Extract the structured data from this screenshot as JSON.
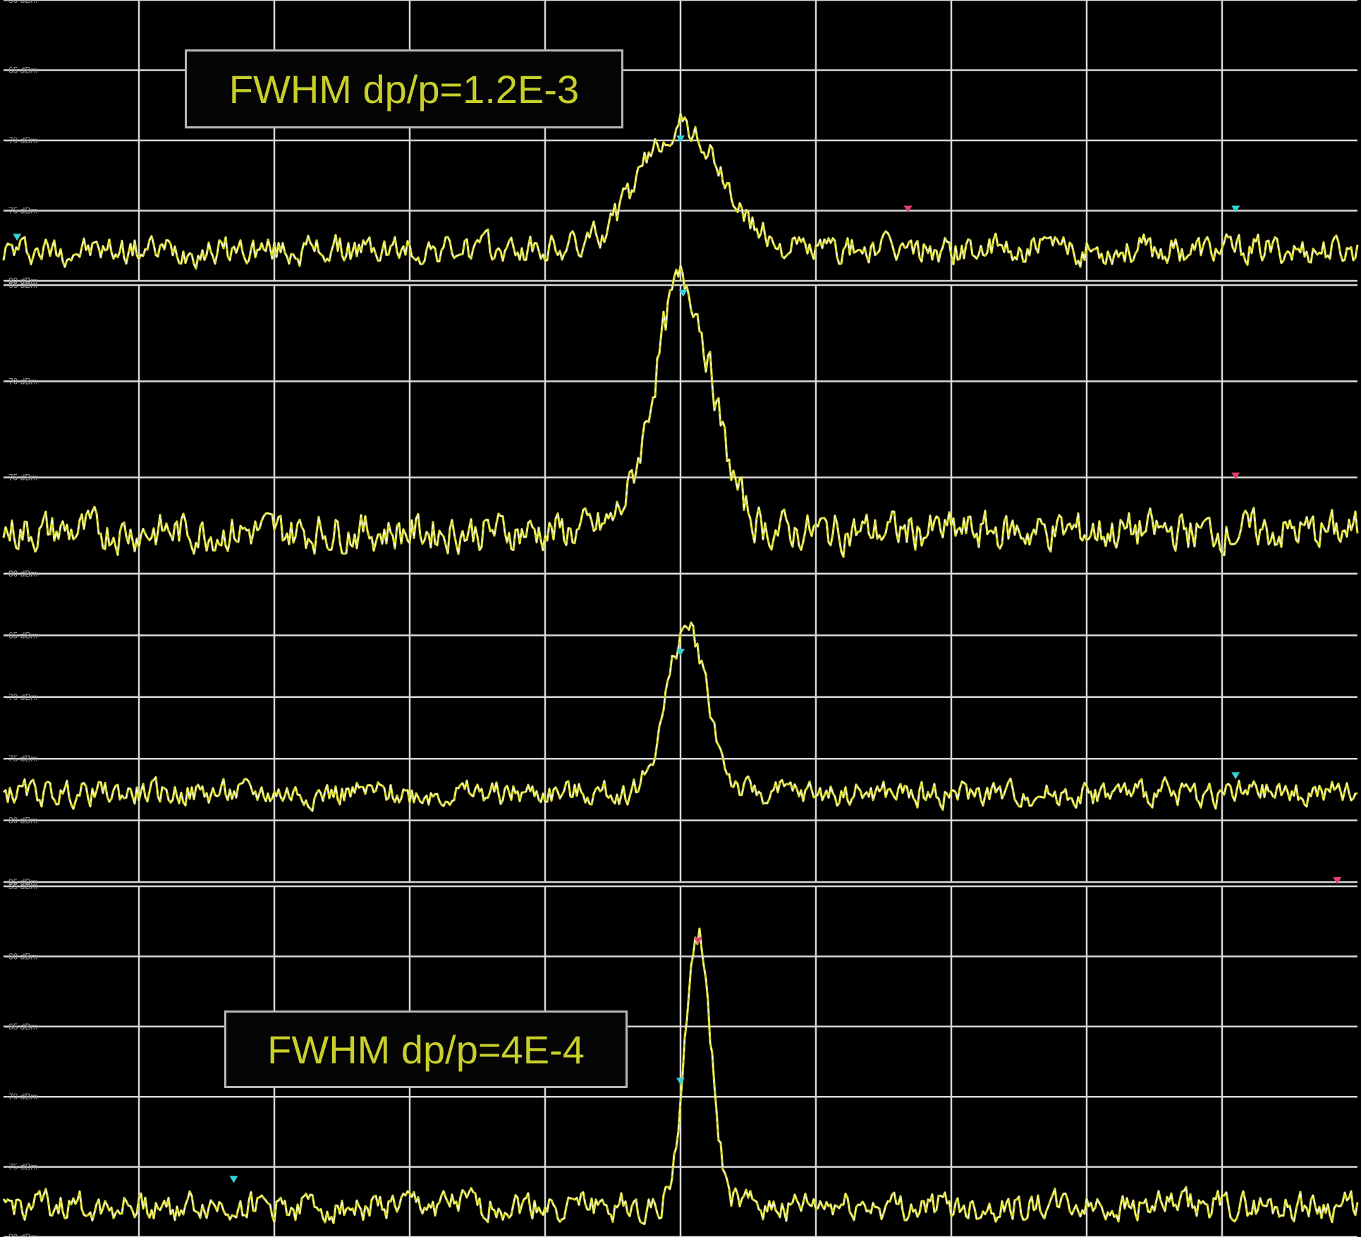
{
  "colors": {
    "background": "#000000",
    "grid": "#d8d8d8",
    "trace": "#ffffff",
    "trace_highlight": "#d4d62a",
    "marker": "#36d0d8",
    "marker_alt": "#e0406a",
    "annotation_text": "#c9cf2a",
    "annotation_border": "#b8b8b8"
  },
  "annotations": {
    "top": "FWHM dp/p=1.2E-3",
    "bottom": "FWHM dp/p=4E-4"
  },
  "chart_data": [
    {
      "type": "line",
      "name": "panel-1",
      "ylim": [
        -80,
        -60
      ],
      "y_tick_labels": [
        "-60 dBm",
        "-65 dBm",
        "-70 dBm",
        "-75 dBm",
        "-80 dBm"
      ],
      "x_divisions": 10,
      "noise_floor_dbm": -79,
      "peak": {
        "x_div": 5.0,
        "y_dbm": -70.2,
        "fwhm_div": 0.7
      },
      "markers": [
        {
          "x_div": 5.0,
          "y_dbm": -70.0,
          "color": "marker"
        },
        {
          "x_div": 6.68,
          "y_dbm": -75.0,
          "color": "marker_alt"
        },
        {
          "x_div": 9.1,
          "y_dbm": -75.0,
          "color": "marker"
        },
        {
          "x_div": 0.1,
          "y_dbm": -77.0,
          "color": "marker"
        }
      ]
    },
    {
      "type": "line",
      "name": "panel-2",
      "ylim": [
        -80,
        -65
      ],
      "y_tick_labels": [
        "-65 dBm",
        "-70 dBm",
        "-75 dBm",
        "-80 dBm"
      ],
      "x_divisions": 10,
      "noise_floor_dbm": -79,
      "peak": {
        "x_div": 5.02,
        "y_dbm": -66.0,
        "fwhm_div": 0.5
      },
      "markers": [
        {
          "x_div": 5.02,
          "y_dbm": -65.5,
          "color": "marker"
        },
        {
          "x_div": 9.1,
          "y_dbm": -75.0,
          "color": "marker_alt"
        }
      ]
    },
    {
      "type": "line",
      "name": "panel-3",
      "ylim": [
        -85,
        -60
      ],
      "y_tick_labels": [
        "-60 dBm",
        "-65 dBm",
        "-70 dBm",
        "-75 dBm",
        "-80 dBm",
        "-85 dBm"
      ],
      "x_divisions": 10,
      "noise_floor_dbm": -79,
      "peak": {
        "x_div": 5.05,
        "y_dbm": -65.5,
        "fwhm_div": 0.35
      },
      "markers": [
        {
          "x_div": 5.0,
          "y_dbm": -66.5,
          "color": "marker"
        },
        {
          "x_div": 9.1,
          "y_dbm": -76.5,
          "color": "marker"
        },
        {
          "x_div": 9.85,
          "y_dbm": -85.0,
          "color": "marker_alt"
        }
      ]
    },
    {
      "type": "line",
      "name": "panel-4",
      "ylim": [
        -80,
        -55
      ],
      "y_tick_labels": [
        "-55 dBm",
        "-60 dBm",
        "-65 dBm",
        "-70 dBm",
        "-75 dBm",
        "-80 dBm"
      ],
      "x_divisions": 10,
      "noise_floor_dbm": -79,
      "peak": {
        "x_div": 5.13,
        "y_dbm": -59.5,
        "fwhm_div": 0.22
      },
      "markers": [
        {
          "x_div": 5.13,
          "y_dbm": -59.0,
          "color": "marker_alt"
        },
        {
          "x_div": 5.0,
          "y_dbm": -69.0,
          "color": "marker"
        },
        {
          "x_div": 1.7,
          "y_dbm": -76.0,
          "color": "marker"
        }
      ]
    }
  ]
}
